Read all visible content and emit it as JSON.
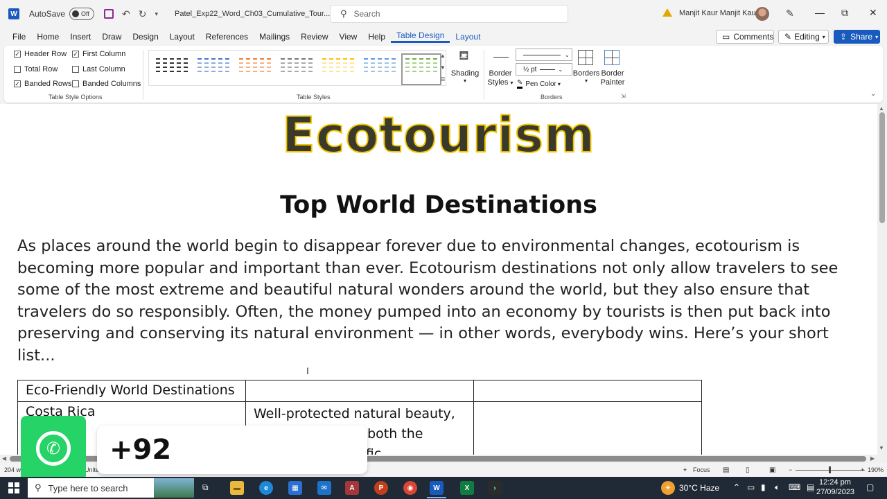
{
  "titlebar": {
    "app_logo": "W",
    "autosave_label": "AutoSave",
    "autosave_state": "Off",
    "doc_title": "Patel_Exp22_Word_Ch03_Cumulative_Tour...",
    "search_placeholder": "Search",
    "user_name": "Manjit Kaur Manjit Kaur"
  },
  "menu": {
    "items": [
      "File",
      "Home",
      "Insert",
      "Draw",
      "Design",
      "Layout",
      "References",
      "Mailings",
      "Review",
      "View",
      "Help",
      "Table Design",
      "Layout"
    ],
    "active": "Table Design",
    "comments_label": "Comments",
    "editing_label": "Editing",
    "share_label": "Share"
  },
  "ribbon": {
    "style_options": {
      "header_row": "Header Row",
      "first_column": "First Column",
      "total_row": "Total Row",
      "last_column": "Last Column",
      "banded_rows": "Banded Rows",
      "banded_columns": "Banded Columns",
      "group_label": "Table Style Options"
    },
    "table_styles_label": "Table Styles",
    "shading_label": "Shading",
    "border_styles_label": "Border Styles",
    "pen_weight": "½ pt",
    "pen_color_label": "Pen Color",
    "borders_label": "Borders",
    "border_painter_label": "Border Painter",
    "borders_group_label": "Borders"
  },
  "document": {
    "heading": "Ecotourism",
    "subheading": "Top World Destinations",
    "paragraph": "As places around the world begin to disappear forever due to environmental changes, ecotourism is becoming more popular and important than ever. Ecotourism destinations not only allow travelers to see some of the most extreme and beautiful natural wonders around the world, but they also ensure that travelers do so responsibly. Often, the money pumped into an economy by tourists is then put back into preserving and conserving its natural environment — in other words, everybody wins. Here’s your short list...",
    "table": {
      "r1c1": "Eco-Friendly World Destinations",
      "r2c1": "Costa Rica",
      "r2c2_l1": "Well-protected natural beauty,",
      "r2c2_l2": "n both the",
      "r2c2_l3": "cific"
    }
  },
  "statusbar": {
    "words": "204 w",
    "language": "United",
    "focus_label": "Focus",
    "zoom": "190%"
  },
  "overlay": {
    "phone_prefix": "+92"
  },
  "taskbar": {
    "search_placeholder": "Type here to search",
    "weather": "30°C  Haze",
    "time": "12:24 pm",
    "date": "27/09/2023"
  },
  "colors": {
    "word_blue": "#185abd",
    "heading_outline": "#f2c500",
    "whatsapp_green": "#25d366",
    "taskbar": "#1f2a36"
  }
}
